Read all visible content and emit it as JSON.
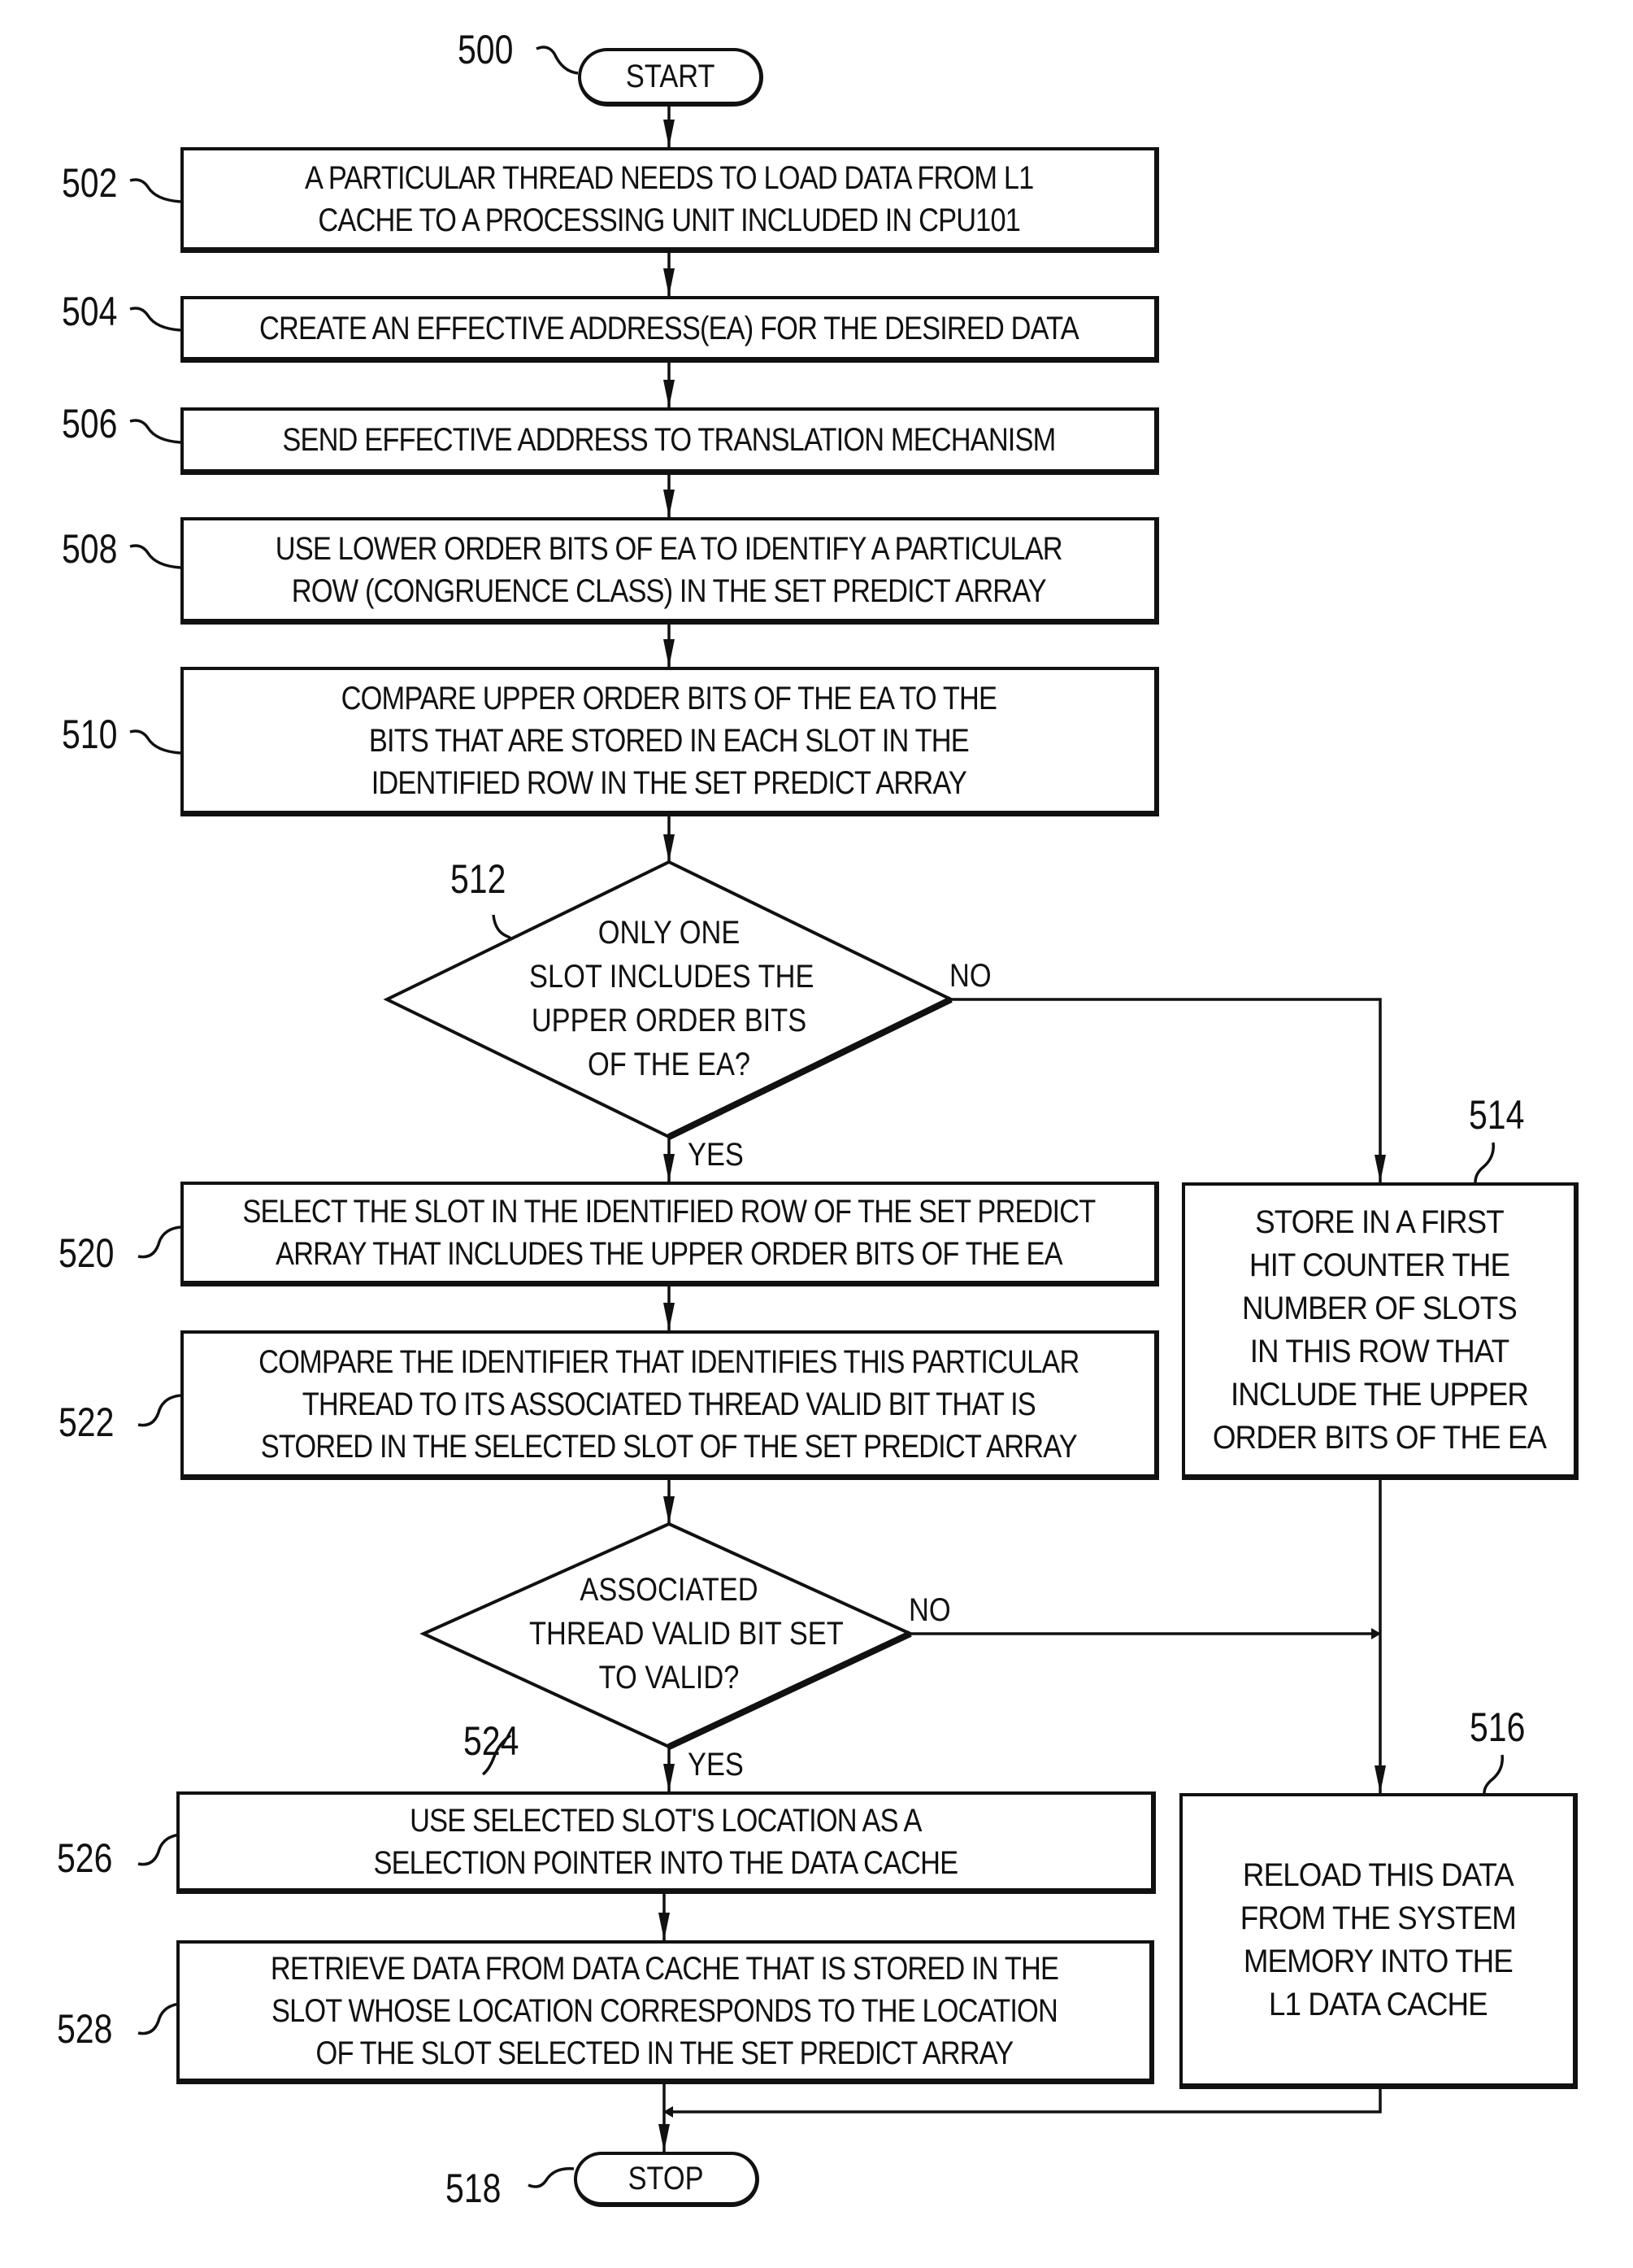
{
  "figure": {
    "start": {
      "ref": "500",
      "label": "START"
    },
    "stop": {
      "ref": "518",
      "label": "STOP"
    },
    "steps": [
      {
        "ref": "502",
        "lines": [
          "A PARTICULAR THREAD NEEDS TO LOAD DATA FROM L1",
          "CACHE TO A PROCESSING UNIT INCLUDED IN CPU101"
        ]
      },
      {
        "ref": "504",
        "lines": [
          "CREATE AN EFFECTIVE ADDRESS(EA) FOR THE DESIRED DATA"
        ]
      },
      {
        "ref": "506",
        "lines": [
          "SEND EFFECTIVE ADDRESS TO TRANSLATION MECHANISM"
        ]
      },
      {
        "ref": "508",
        "lines": [
          "USE LOWER ORDER BITS OF EA TO IDENTIFY A PARTICULAR",
          "ROW (CONGRUENCE CLASS) IN THE SET PREDICT ARRAY"
        ]
      },
      {
        "ref": "510",
        "lines": [
          "COMPARE UPPER ORDER BITS OF THE EA TO THE",
          "BITS THAT ARE STORED IN EACH SLOT IN THE",
          "IDENTIFIED ROW IN THE SET PREDICT ARRAY"
        ]
      },
      {
        "ref": "520",
        "lines": [
          "SELECT THE SLOT IN THE IDENTIFIED ROW OF THE SET PREDICT",
          "ARRAY THAT INCLUDES THE UPPER ORDER BITS OF THE EA"
        ]
      },
      {
        "ref": "522",
        "lines": [
          "COMPARE THE IDENTIFIER THAT IDENTIFIES THIS PARTICULAR",
          "THREAD TO ITS ASSOCIATED THREAD VALID BIT THAT IS",
          "STORED IN THE SELECTED SLOT OF THE SET PREDICT ARRAY"
        ]
      },
      {
        "ref": "526",
        "lines": [
          "USE SELECTED SLOT'S LOCATION AS A",
          "SELECTION POINTER INTO THE DATA CACHE"
        ]
      },
      {
        "ref": "528",
        "lines": [
          "RETRIEVE DATA FROM DATA CACHE THAT IS STORED IN THE",
          "SLOT WHOSE LOCATION CORRESPONDS TO THE LOCATION",
          "OF THE SLOT SELECTED IN THE SET PREDICT ARRAY"
        ]
      },
      {
        "ref": "514",
        "lines": [
          "STORE IN A FIRST",
          "HIT COUNTER THE",
          "NUMBER OF SLOTS",
          "IN THIS ROW THAT",
          "INCLUDE THE UPPER",
          "ORDER BITS OF THE EA"
        ]
      },
      {
        "ref": "516",
        "lines": [
          "RELOAD THIS DATA",
          "FROM THE SYSTEM",
          "MEMORY INTO THE",
          "L1 DATA CACHE"
        ]
      }
    ],
    "decisions": [
      {
        "ref": "512",
        "lines": [
          "ONLY ONE",
          "SLOT INCLUDES THE",
          "UPPER ORDER BITS",
          "OF THE EA?"
        ],
        "yes": "YES",
        "no": "NO"
      },
      {
        "ref": "524",
        "lines": [
          "ASSOCIATED",
          "THREAD VALID BIT SET",
          "TO VALID?"
        ],
        "yes": "YES",
        "no": "NO"
      }
    ]
  }
}
